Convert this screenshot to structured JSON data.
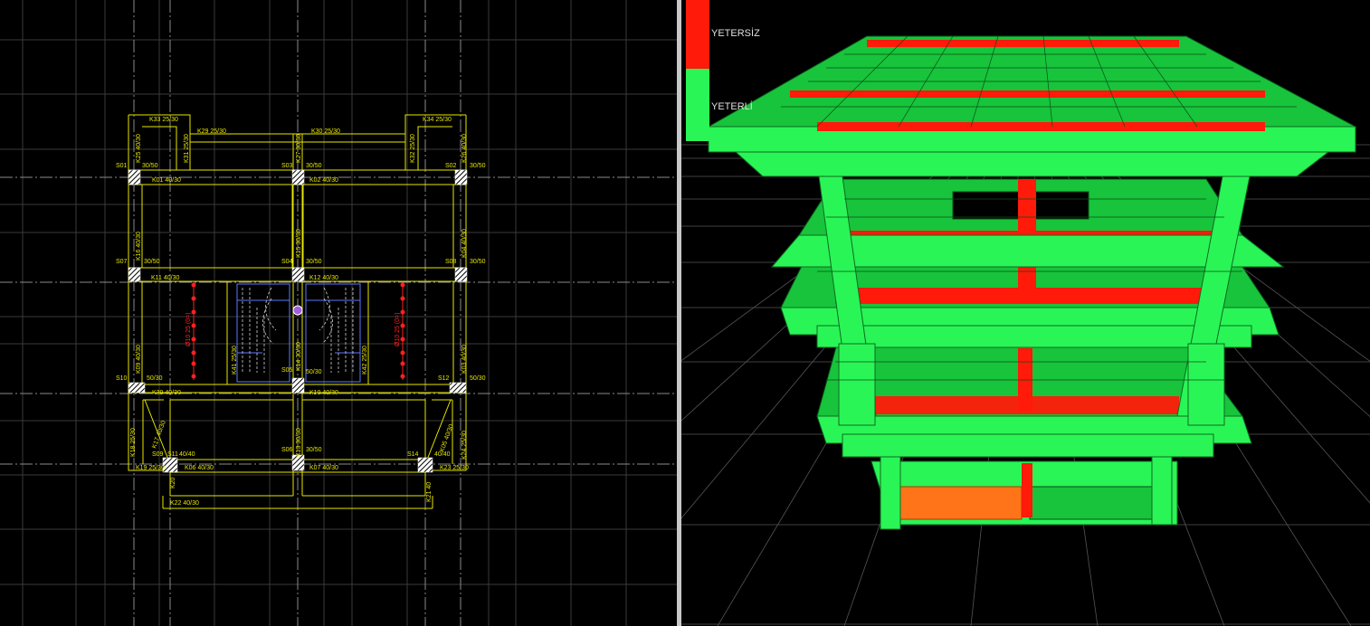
{
  "plan": {
    "beams": [
      {
        "id": "k33",
        "label": "K33 25/30"
      },
      {
        "id": "k34",
        "label": "K34 25/30"
      },
      {
        "id": "k29",
        "label": "K29 25/30"
      },
      {
        "id": "k30",
        "label": "K30 25/30"
      },
      {
        "id": "k25",
        "label": "K25 40/30"
      },
      {
        "id": "k31",
        "label": "K31 25/30"
      },
      {
        "id": "k27",
        "label": "K27 30/30"
      },
      {
        "id": "k32",
        "label": "K32 25/30"
      },
      {
        "id": "k26",
        "label": "K26 40/30"
      },
      {
        "id": "k01",
        "label": "K01 40/30"
      },
      {
        "id": "k02",
        "label": "K02 40/30"
      },
      {
        "id": "k16",
        "label": "K16 40/30"
      },
      {
        "id": "k15",
        "label": "K15 30/30"
      },
      {
        "id": "k04",
        "label": "K04 40/30"
      },
      {
        "id": "k11",
        "label": "K11 40/30"
      },
      {
        "id": "k12",
        "label": "K12 40/30"
      },
      {
        "id": "k09",
        "label": "K09 40/30"
      },
      {
        "id": "k14",
        "label": "K14 30/30"
      },
      {
        "id": "k03",
        "label": "K03 40/30"
      },
      {
        "id": "k39",
        "label": "K39 40/30"
      },
      {
        "id": "k10",
        "label": "K10 40/30"
      },
      {
        "id": "k18",
        "label": "K18 25/30"
      },
      {
        "id": "k13",
        "label": "K13 30/30"
      },
      {
        "id": "k24",
        "label": "K24 25/30"
      },
      {
        "id": "k19",
        "label": "K19 25/30"
      },
      {
        "id": "k06",
        "label": "K06 40/30"
      },
      {
        "id": "k07",
        "label": "K07 40/30"
      },
      {
        "id": "k23",
        "label": "K23 25/30"
      },
      {
        "id": "k22",
        "label": "K22 40/30"
      },
      {
        "id": "k20",
        "label": "K20"
      },
      {
        "id": "k21",
        "label": "K21 40"
      },
      {
        "id": "k41",
        "label": "K41 25/30"
      },
      {
        "id": "k42",
        "label": "K42 25/30"
      },
      {
        "id": "k17",
        "label": "K17 40/30"
      },
      {
        "id": "k05",
        "label": "K05 40/30"
      }
    ],
    "columns": [
      {
        "id": "s01",
        "label": "S01",
        "size": "30/50"
      },
      {
        "id": "s03",
        "label": "S03",
        "size": "30/50"
      },
      {
        "id": "s02",
        "label": "S02",
        "size": "30/50"
      },
      {
        "id": "s07",
        "label": "S07",
        "size": "30/50"
      },
      {
        "id": "s04",
        "label": "S04",
        "size": "30/50"
      },
      {
        "id": "s08",
        "label": "S08",
        "size": "30/50"
      },
      {
        "id": "s10",
        "label": "S10",
        "size": "50/30"
      },
      {
        "id": "s05",
        "label": "S05",
        "size": "50/30"
      },
      {
        "id": "s12",
        "label": "S12",
        "size": "50/30"
      },
      {
        "id": "s06",
        "label": "S06",
        "size": "30/50"
      },
      {
        "id": "s09",
        "label": "S09",
        "size": "40/40"
      },
      {
        "id": "s14",
        "label": "S14",
        "size": "40/40"
      },
      {
        "id": "s11",
        "label": "S11",
        "size": ""
      }
    ],
    "rebars": [
      {
        "id": "left",
        "label": "Ø10 25 (0=)"
      },
      {
        "id": "right",
        "label": "Ø10 25 (0=)"
      }
    ]
  },
  "legend": {
    "insufficient": "YETERSİZ",
    "sufficient": "YETERLİ"
  },
  "colors": {
    "background": "#000000",
    "plan_lines": "#e6e600",
    "grid": "#3a3a3a",
    "sufficient": "#2af556",
    "sufficient_dark": "#16c43c",
    "insufficient": "#ff1a0a",
    "warning": "#ff7418",
    "stair": "#5a78ff"
  }
}
